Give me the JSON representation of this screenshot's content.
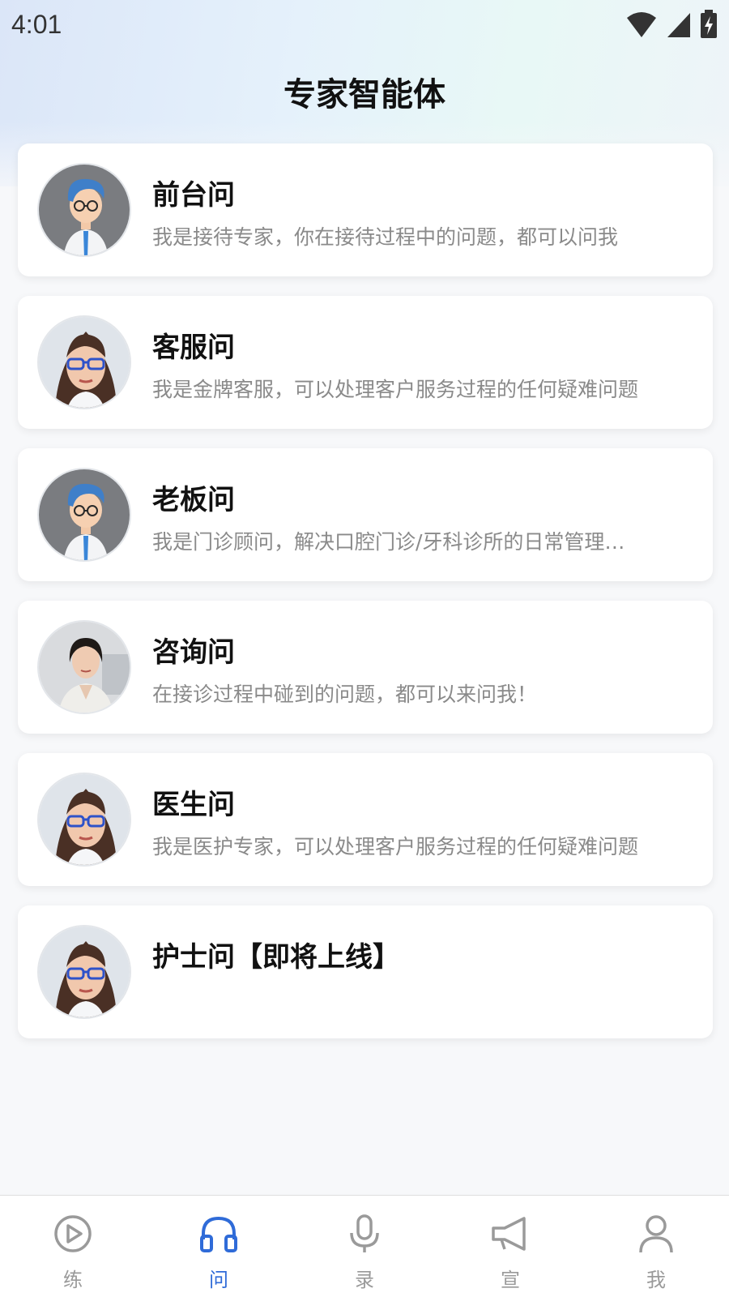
{
  "status_bar": {
    "time": "4:01",
    "icons": [
      "wifi-icon",
      "cellular-signal-icon",
      "battery-charging-icon"
    ]
  },
  "header": {
    "title": "专家智能体"
  },
  "experts": [
    {
      "title": "前台问",
      "desc": "我是接待专家，你在接待过程中的问题，都可以问我",
      "avatar": "cartoon-doctor-avatar"
    },
    {
      "title": "客服问",
      "desc": "我是金牌客服，可以处理客户服务过程的任何疑难问题",
      "avatar": "woman-glasses-avatar"
    },
    {
      "title": "老板问",
      "desc": "我是门诊顾问，解决口腔门诊/牙科诊所的日常管理…",
      "avatar": "cartoon-doctor-avatar"
    },
    {
      "title": "咨询问",
      "desc": "在接诊过程中碰到的问题，都可以来问我！",
      "avatar": "woman-consultant-avatar"
    },
    {
      "title": "医生问",
      "desc": "我是医护专家，可以处理客户服务过程的任何疑难问题",
      "avatar": "woman-glasses-avatar"
    },
    {
      "title": "护士问【即将上线】",
      "desc": "",
      "avatar": "woman-glasses-avatar"
    }
  ],
  "tabbar": {
    "items": [
      {
        "label": "练",
        "icon": "play-circle-icon",
        "active": false
      },
      {
        "label": "问",
        "icon": "headphones-icon",
        "active": true
      },
      {
        "label": "录",
        "icon": "microphone-icon",
        "active": false
      },
      {
        "label": "宣",
        "icon": "megaphone-icon",
        "active": false
      },
      {
        "label": "我",
        "icon": "user-icon",
        "active": false
      }
    ],
    "active_color": "#2f6bd8",
    "inactive_color": "#9a9a9a"
  }
}
